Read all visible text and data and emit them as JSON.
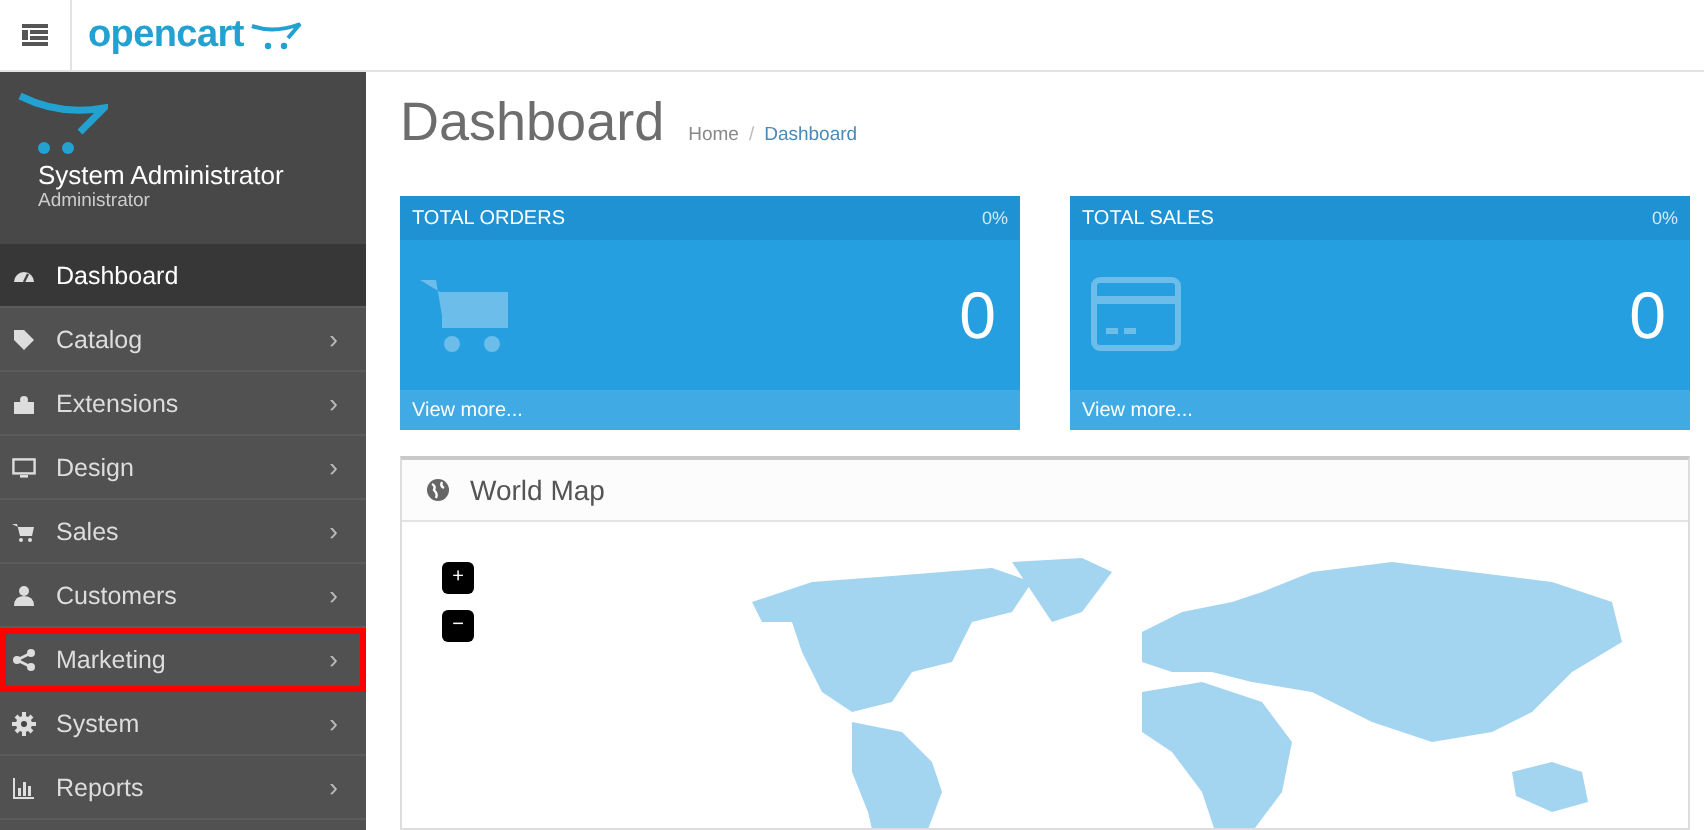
{
  "header": {
    "logo": "opencart"
  },
  "profile": {
    "name": "System Administrator",
    "role": "Administrator"
  },
  "menu": [
    {
      "label": "Dashboard",
      "selected": true,
      "has_children": false,
      "highlighted": false
    },
    {
      "label": "Catalog",
      "selected": false,
      "has_children": true,
      "highlighted": false
    },
    {
      "label": "Extensions",
      "selected": false,
      "has_children": true,
      "highlighted": false
    },
    {
      "label": "Design",
      "selected": false,
      "has_children": true,
      "highlighted": false
    },
    {
      "label": "Sales",
      "selected": false,
      "has_children": true,
      "highlighted": false
    },
    {
      "label": "Customers",
      "selected": false,
      "has_children": true,
      "highlighted": false
    },
    {
      "label": "Marketing",
      "selected": false,
      "has_children": true,
      "highlighted": true
    },
    {
      "label": "System",
      "selected": false,
      "has_children": true,
      "highlighted": false
    },
    {
      "label": "Reports",
      "selected": false,
      "has_children": true,
      "highlighted": false
    }
  ],
  "chevron": "›",
  "page": {
    "title": "Dashboard",
    "breadcrumb": [
      "Home",
      "Dashboard"
    ],
    "separator": "/"
  },
  "tiles": [
    {
      "title": "TOTAL ORDERS",
      "percent": "0%",
      "value": "0",
      "link": "View more..."
    },
    {
      "title": "TOTAL SALES",
      "percent": "0%",
      "value": "0",
      "link": "View more..."
    }
  ],
  "map_panel": {
    "title": "World Map",
    "zoom_in": "+",
    "zoom_out": "−"
  }
}
